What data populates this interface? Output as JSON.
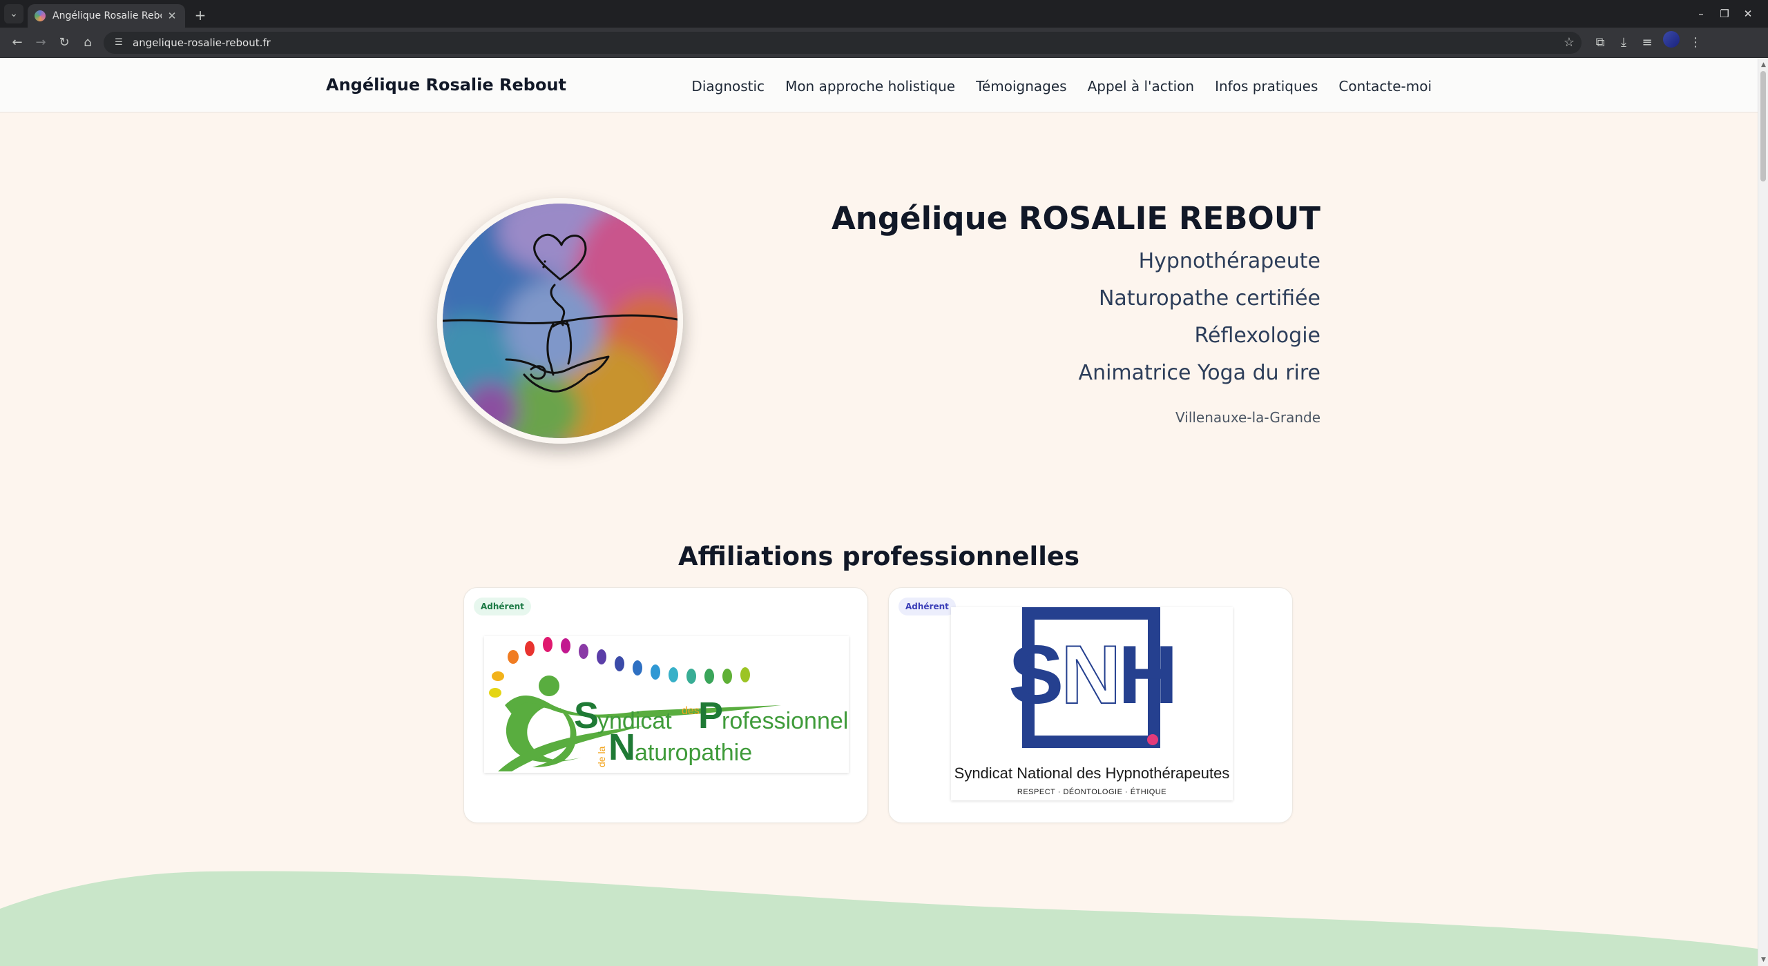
{
  "browser": {
    "tab_title": "Angélique Rosalie Rebout – ",
    "url": "angelique-rosalie-rebout.fr",
    "tab_close": "✕",
    "new_tab": "+"
  },
  "header": {
    "brand": "Angélique Rosalie Rebout",
    "nav": [
      "Diagnostic",
      "Mon approche holistique",
      "Témoignages",
      "Appel à l'action",
      "Infos pratiques",
      "Contacte-moi"
    ]
  },
  "hero": {
    "name": "Angélique ROSALIE REBOUT",
    "roles": [
      "Hypnothérapeute",
      "Naturopathe certifiée",
      "Réflexologie",
      "Animatrice Yoga du rire"
    ],
    "city": "Villenauxe-la-Grande"
  },
  "affiliations": {
    "title": "Affiliations professionnelles",
    "cards": [
      {
        "badge": "Adhérent",
        "logo_text": {
          "s": "S",
          "yndicat": "yndicat",
          "des": "des",
          "p": "P",
          "rofessionnels": "rofessionnels",
          "dela": "de la",
          "n": "N",
          "aturopathie": "aturopathie"
        }
      },
      {
        "badge": "Adhérent",
        "logo_text": {
          "s": "S",
          "n": "N",
          "h": "H",
          "name": "Syndicat National des Hypnothérapeutes",
          "tagline": "RESPECT · DÉONTOLOGIE · ÉTHIQUE"
        }
      }
    ]
  },
  "colors": {
    "page_bg": "#fdf5ee",
    "accent_green": "#3f9b3a",
    "snh_blue": "#25408f",
    "wave_green": "#c9e6c9"
  }
}
